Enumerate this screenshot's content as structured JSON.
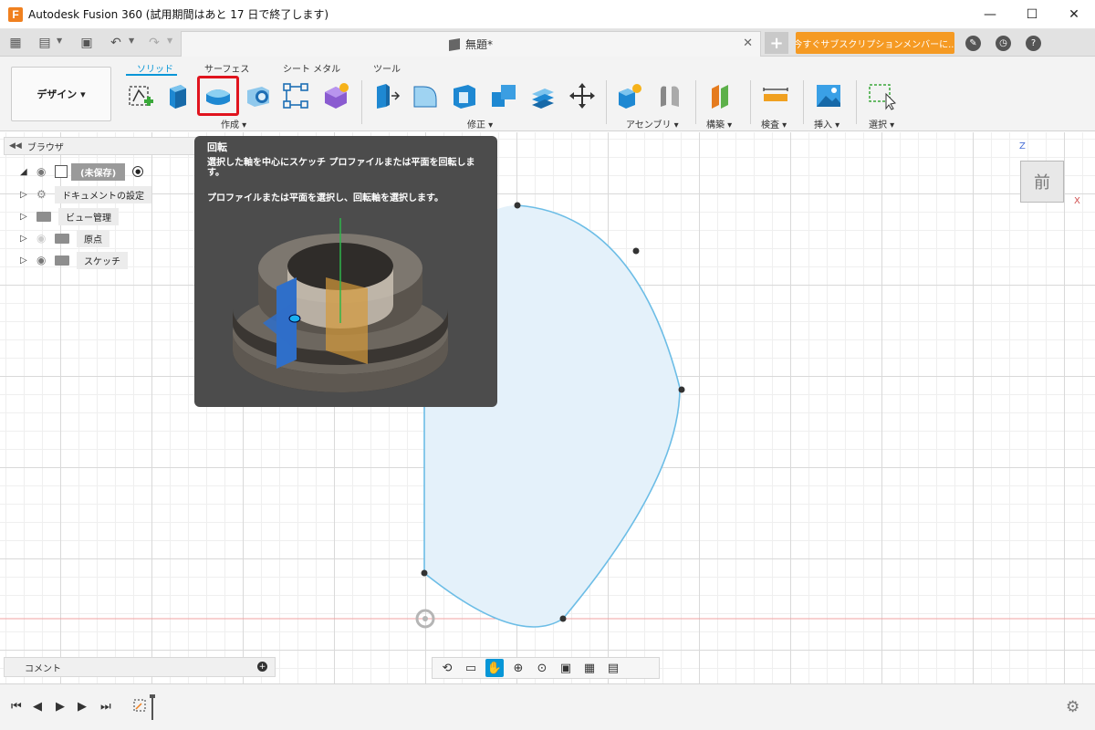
{
  "window": {
    "title": "Autodesk Fusion 360 (試用期間はあと 17 日で終了します)",
    "logo_letter": "F",
    "minimize": "—",
    "maximize": "☐",
    "close": "✕"
  },
  "tabbar": {
    "doc_tab_label": "無題*",
    "doc_tab_close": "✕",
    "new_tab": "+",
    "subscribe_label": "今すぐサブスクリプションメンバーに..."
  },
  "ribbon": {
    "workspace_label": "デザイン ▾",
    "tabs": [
      "ソリッド",
      "サーフェス",
      "シート メタル",
      "ツール"
    ],
    "groups": {
      "create": "作成 ▾",
      "modify": "修正 ▾",
      "assemble": "アセンブリ ▾",
      "construct": "構築 ▾",
      "inspect": "検査 ▾",
      "insert": "挿入 ▾",
      "select": "選択 ▾"
    }
  },
  "browser": {
    "header": "ブラウザ",
    "root_label": "(未保存)",
    "items": [
      "ドキュメントの設定",
      "ビュー管理",
      "原点",
      "スケッチ"
    ]
  },
  "comment": {
    "label": "コメント"
  },
  "viewcube": {
    "face_label": "前",
    "axis_z": "Z",
    "axis_x": "X"
  },
  "tooltip": {
    "title": "回転",
    "description": "選択した軸を中心にスケッチ プロファイルまたは平面を回転します。",
    "instruction": "プロファイルまたは平面を選択し、回転軸を選択します。"
  },
  "colors": {
    "accent": "#0696d7",
    "highlight": "#e0141e",
    "subscribe": "#f59a23",
    "sketch_line": "#6cbde6",
    "sketch_fill": "#e4f1fa"
  }
}
